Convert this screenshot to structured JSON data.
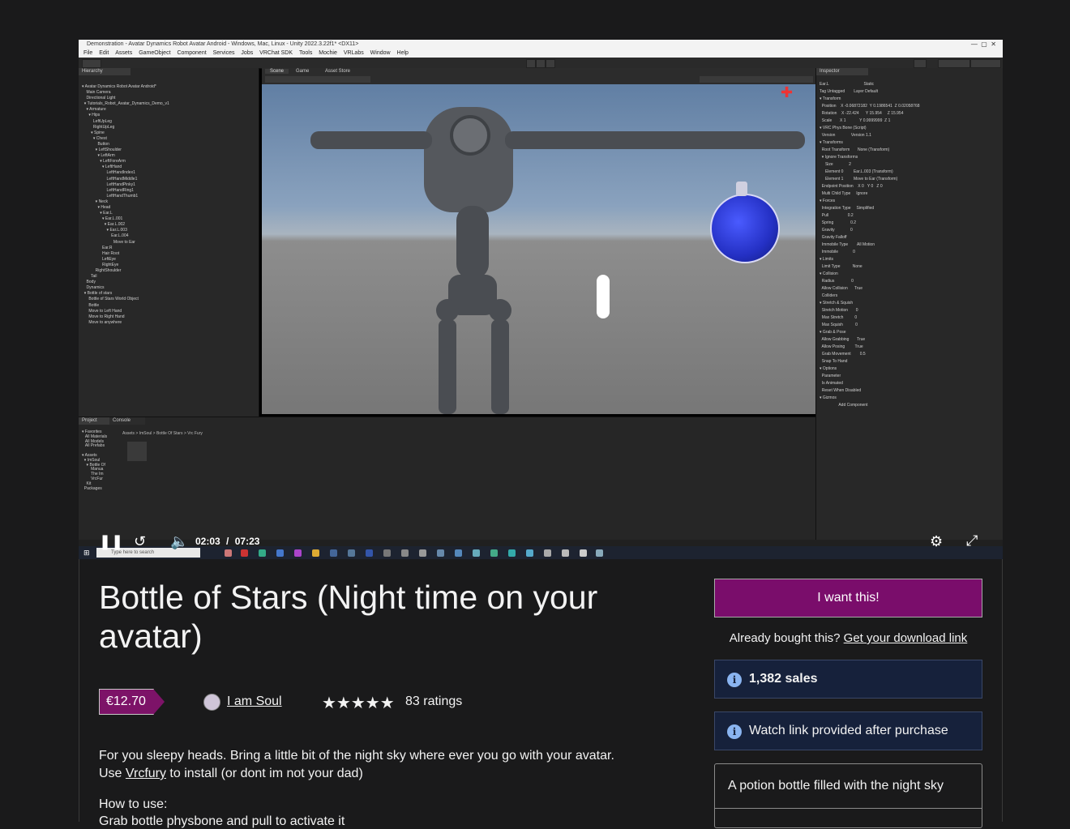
{
  "video": {
    "window_title": "Demonstration - Avatar Dynamics Robot Avatar Android - Windows, Mac, Linux - Unity 2022.3.22f1* <DX11>",
    "menu": [
      "File",
      "Edit",
      "Assets",
      "GameObject",
      "Component",
      "Services",
      "Jobs",
      "VRChat SDK",
      "Tools",
      "Mochie",
      "VRLabs",
      "Window",
      "Help"
    ],
    "time_current": "02:03",
    "time_sep": "/",
    "time_total": "07:23",
    "hierarchy_tab": "Hierarchy",
    "scene_tab": "Scene",
    "game_tab": "Game",
    "asset_store_tab": "Asset Store",
    "inspector_tab": "Inspector",
    "project_tab": "Project",
    "console_tab": "Console",
    "hierarchy_text": "▾ Avatar Dynamics Robot Avatar Android*\n    Main Camera\n    Directional Light\n  ▾ Tutorials_Robot_Avatar_Dynamics_Demo_v1\n    ▾ Armature\n      ▾ Hips\n          LeftUpLeg\n          RightUpLeg\n        ▾ Spine\n          ▾ Chest\n              Button\n            ▾ LeftShoulder\n              ▾ LeftArm\n                ▾ LeftForeArm\n                  ▾ LeftHand\n                      LeftHandIndex1\n                      LeftHandMiddle1\n                      LeftHandPinky1\n                      LeftHandRing1\n                      LeftHandThumb1\n            ▾ Neck\n              ▾ Head\n                ▾ Ear.L\n                  ▾ Ear.L.001\n                    ▾ Ear.L.002\n                      ▾ Ear.L.003\n                          Ear.L.004\n                            Move to Ear\n                  Ear.R\n                  Hair Root\n                  LeftEye\n                  RightEye\n            RightShoulder\n        Tail\n    Body\n    Dynamics\n  ▾ Bottle of stars\n      Bottle of Stars World Object\n      Bottle\n      Move to Left Hand\n      Move to Right Hand\n      Move to anywhere",
    "inspector_text": "Ear.L                               Static\nTag Untagged        Layer Default\n▾ Transform\n  Position    X -0.06872182  Y 0.1986541  Z 0.02058768\n  Rotation    X -22.424      Y 15.954     Z 15.954\n  Scale       X 1            Y 0.9999999  Z 1\n▾ VRC Phys Bone (Script)\n  Version              Version 1.1\n▾ Transforms\n  Root Transform       None (Transform)\n  ▾ Ignore Transforms\n     Size              2\n     Element 0         Ear.L.003 (Transform)\n     Element 1         Move to Ear (Transform)\n  Endpoint Position    X 0   Y 0   Z 0\n  Multi Child Type     Ignore\n▾ Forces\n  Integration Type     Simplified\n  Pull                 0.2\n  Spring               0.2\n  Gravity              0\n  Gravity Falloff\n  Immobile Type        All Motion\n  Immobile             0\n▾ Limits\n  Limit Type           None\n▾ Collision\n  Radius               0\n  Allow Collision      True\n  Colliders\n▾ Stretch & Squish\n  Stretch Motion       0\n  Max Stretch          0\n  Max Squish           0\n▾ Grab & Pose\n  Allow Grabbing       True\n  Allow Posing         True\n  Grab Movement        0.5\n  Snap To Hand\n▾ Options\n  Parameter\n  Is Animated\n  Reset When Disabled\n▾ Gizmos\n                 Add Component",
    "project_text": "▾ Favorites\n   All Materials\n   All Models\n   All Prefabs\n\n▾ Assets\n  ▾ ImSoul\n    ▾ Bottle Of\n        Manua\n        The Im\n        VrcFur\n    Kit\n  Packages",
    "breadcrumb": "Assets > ImSoul > Bottle Of Stars > Vrc Fury",
    "taskbar_search": "Type here to search"
  },
  "product": {
    "title": "Bottle of Stars (Night time on your avatar)",
    "price": "€12.70",
    "seller": "I am Soul",
    "stars": "★★★★★",
    "ratings": "83 ratings",
    "desc_line1": "For you sleepy heads. Bring a little bit of the night sky where ever you go with your avatar.",
    "desc_line2_pre": "Use ",
    "desc_line2_link": "Vrcfury",
    "desc_line2_post": " to install (or dont im not your dad)",
    "howto": "How to use:",
    "howto_line": "Grab bottle physbone and pull to activate it"
  },
  "sidebar": {
    "buy_label": "I want this!",
    "already_text": "Already bought this? ",
    "download_link": "Get your download link",
    "sales": "1,382 sales",
    "watch_link": "Watch link provided after purchase",
    "summary": "A potion bottle filled with the night sky",
    "info_glyph": "i"
  },
  "colors": {
    "buy_button": "#7a0d6b",
    "price_tag": "#7d1368",
    "info_box": "#16213b",
    "page_bg": "#1a1a1b"
  }
}
